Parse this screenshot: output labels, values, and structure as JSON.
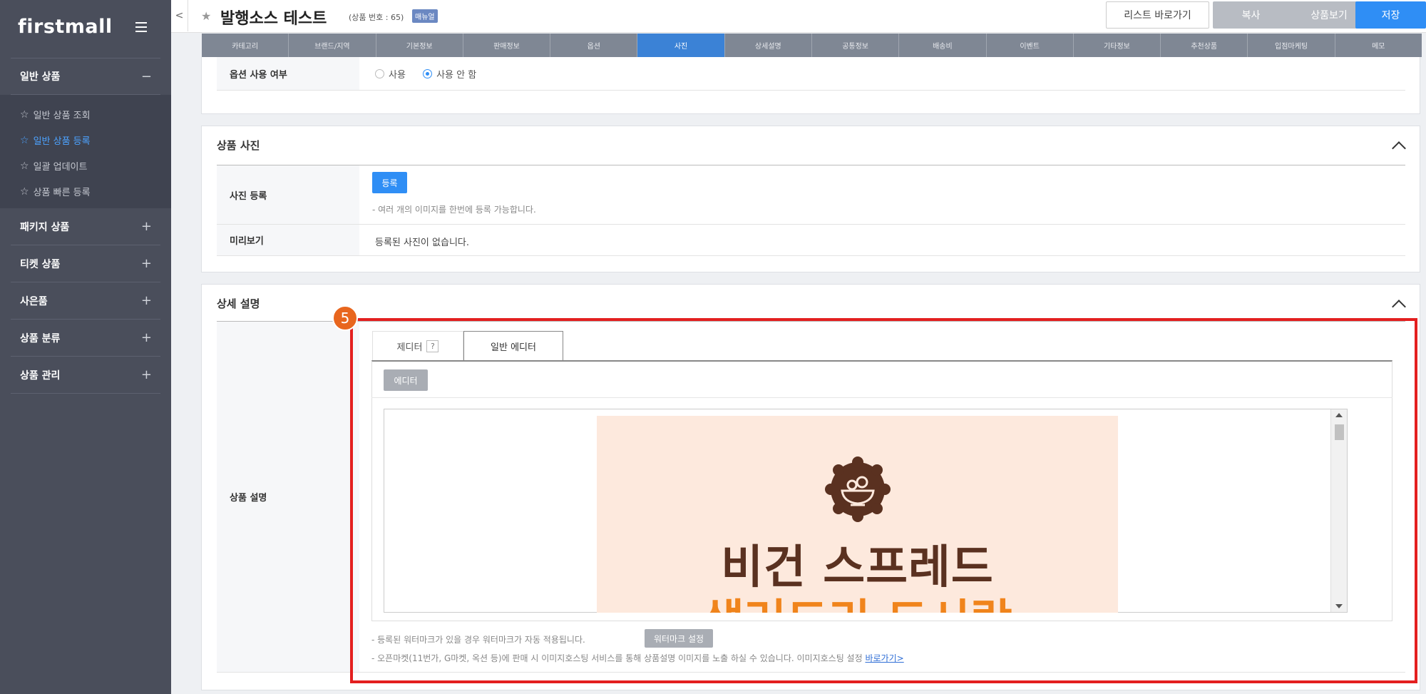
{
  "sidebar": {
    "logo": "firstmall",
    "sections": [
      {
        "label": "일반 상품",
        "sign": "−"
      },
      {
        "label": "패키지 상품",
        "sign": "+"
      },
      {
        "label": "티켓 상품",
        "sign": "+"
      },
      {
        "label": "사은품",
        "sign": "+"
      },
      {
        "label": "상품 분류",
        "sign": "+"
      },
      {
        "label": "상품 관리",
        "sign": "+"
      }
    ],
    "subitems": [
      {
        "label": "일반 상품 조회"
      },
      {
        "label": "일반 상품 등록"
      },
      {
        "label": "일괄 업데이트"
      },
      {
        "label": "상품 빠른 등록"
      }
    ]
  },
  "header": {
    "collapse": "<",
    "title": "발행소스 테스트",
    "product_no": "(상품 번호 : 65)",
    "badge": "매뉴얼",
    "buttons": {
      "list": "리스트 바로가기",
      "copy": "복사",
      "view": "상품보기",
      "save": "저장"
    }
  },
  "tabs": [
    "카테고리",
    "브랜드/지역",
    "기본정보",
    "판매정보",
    "옵션",
    "사진",
    "상세설명",
    "공통정보",
    "배송비",
    "이벤트",
    "기타정보",
    "추천상품",
    "입점마케팅",
    "메모"
  ],
  "option_section": {
    "label": "옵션 사용 여부",
    "option_use": "사용",
    "option_not_use": "사용 안 함"
  },
  "photo_section": {
    "title": "상품 사진",
    "register_label": "사진 등록",
    "register_button": "등록",
    "register_note": "-  여러 개의 이미지를 한번에 등록 가능합니다.",
    "preview_label": "미리보기",
    "preview_value": "등록된 사진이 없습니다."
  },
  "detail_section": {
    "title": "상세 설명",
    "step_number": "5",
    "row_label": "상품 설명",
    "editor_tabs": {
      "tab1": "제디터",
      "tab1_help": "?",
      "tab2": "일반 에디터"
    },
    "editor_button": "에디터",
    "image_text_line1": "비건 스프레드",
    "image_text_line2": "샐러드리 드시락",
    "note1": "-  등록된 워터마크가 있을 경우 워터마크가 자동 적용됩니다.",
    "watermark_button": "워터마크 설정",
    "note2": "-  오픈마켓(11번가, G마켓, 옥션 등)에 판매 시 이미지호스팅 서비스를 통해 상품설명 이미지를 노출 하실 수 있습니다. 이미지호스팅 설정",
    "note2_link": "바로가기>"
  },
  "colors": {
    "sidebar_bg": "#4a4e5b",
    "accent_blue": "#2f8ef5",
    "highlight_red": "#e31f1f",
    "step_orange": "#e8661e",
    "image_bg": "#fde9dd",
    "image_brown": "#5a3120",
    "image_orange": "#f0841c"
  }
}
